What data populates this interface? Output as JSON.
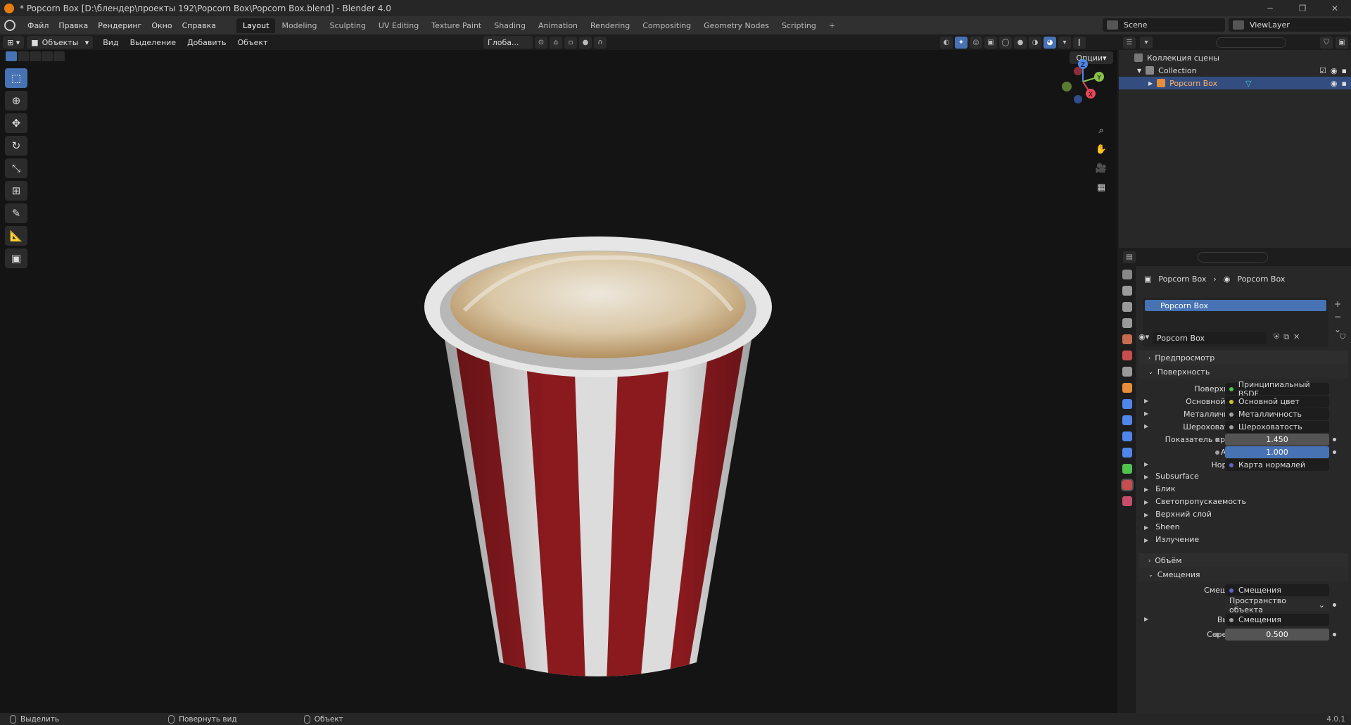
{
  "window": {
    "title": "* Popcorn Box [D:\\блендер\\проекты 192\\Popcorn Box\\Popcorn Box.blend] - Blender 4.0",
    "controls": [
      "─",
      "❐",
      "✕"
    ]
  },
  "menu": [
    "Файл",
    "Правка",
    "Рендеринг",
    "Окно",
    "Справка"
  ],
  "workspaces": [
    "Layout",
    "Modeling",
    "Sculpting",
    "UV Editing",
    "Texture Paint",
    "Shading",
    "Animation",
    "Rendering",
    "Compositing",
    "Geometry Nodes",
    "Scripting"
  ],
  "active_workspace": "Layout",
  "scene": "Scene",
  "view_layer": "ViewLayer",
  "viewport": {
    "mode": "Объекты",
    "menus": [
      "Вид",
      "Выделение",
      "Добавить",
      "Объект"
    ],
    "orientation": "Глоба...",
    "options": "Опции"
  },
  "gizmo": {
    "z": "Z",
    "y": "Y",
    "x": "X"
  },
  "outliner": {
    "scene_collection": "Коллекция сцены",
    "collection": "Collection",
    "object": "Popcorn Box"
  },
  "properties": {
    "breadcrumb": [
      "Popcorn Box",
      "Popcorn Box"
    ],
    "material_slot": "Popcorn Box",
    "material_name": "Popcorn Box",
    "sections": {
      "preview": "Предпросмотр",
      "surface": "Поверхность",
      "volume": "Объём",
      "displacement": "Смещения"
    },
    "surface_rows": [
      {
        "label": "Поверхность",
        "value": "Принципиальный BSDF",
        "dot": "#4ec34e"
      },
      {
        "label": "Основной цвет",
        "value": "Основной цвет",
        "dot": "#c7c729",
        "arrow": true
      },
      {
        "label": "Металличность",
        "value": "Металличность",
        "dot": "#a1a1a1",
        "arrow": true
      },
      {
        "label": "Шероховатость",
        "value": "Шероховатость",
        "dot": "#a1a1a1",
        "arrow": true
      },
      {
        "label": "Показатель прело...",
        "value": "1.450",
        "num": true
      },
      {
        "label": "Альфа",
        "value": "1.000",
        "num": true,
        "blue": true
      },
      {
        "label": "Нормаль",
        "value": "Карта нормалей",
        "dot": "#6363c7",
        "arrow": true
      }
    ],
    "subpanels": [
      "Subsurface",
      "Блик",
      "Светопропускаемость",
      "Верхний слой",
      "Sheen",
      "Излучение"
    ],
    "displacement_rows": [
      {
        "label": "Смещения",
        "value": "Смещения",
        "dot": "#6363c7"
      },
      {
        "label": "",
        "value": "Пространство объекта",
        "dropdown": true
      },
      {
        "label": "Высота",
        "value": "Смещения",
        "dot": "#a1a1a1",
        "arrow": true
      },
      {
        "label": "Середина",
        "value": "0.500",
        "num": true
      }
    ]
  },
  "status": {
    "select": "Выделить",
    "rotate": "Повернуть вид",
    "object": "Объект",
    "version": "4.0.1"
  }
}
